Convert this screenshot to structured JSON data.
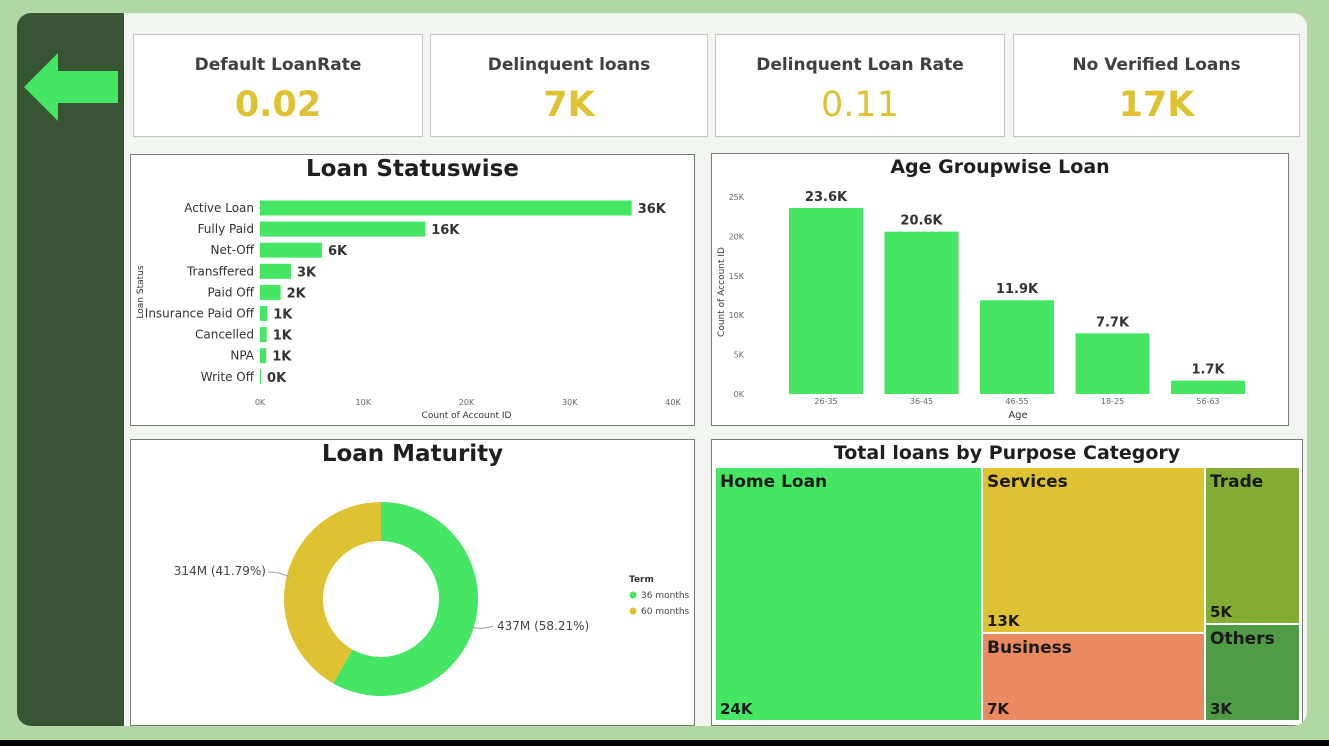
{
  "nav": {
    "back_icon": "arrow-left-icon",
    "accent": "#45e663"
  },
  "kpis": [
    {
      "label": "Default LoanRate",
      "value": "0.02"
    },
    {
      "label": "Delinquent loans",
      "value": "7K"
    },
    {
      "label": "Delinquent Loan Rate",
      "value": "0.11"
    },
    {
      "label": "No Verified Loans",
      "value": "17K"
    }
  ],
  "colors": {
    "green": "#45e663",
    "gold": "#dfc232",
    "salmon": "#ea8a60",
    "olive": "#83ad34",
    "dark_green": "#4f9b46"
  },
  "chart_data": [
    {
      "type": "bar",
      "orientation": "horizontal",
      "title": "Loan Statuswise",
      "xlabel": "Count of Account ID",
      "ylabel": "Loan Status",
      "categories": [
        "Active Loan",
        "Fully Paid",
        "Net-Off",
        "Transffered",
        "Paid Off",
        "Insurance Paid Off",
        "Cancelled",
        "NPA",
        "Write Off"
      ],
      "values": [
        36000,
        16000,
        6000,
        3000,
        2000,
        700,
        650,
        600,
        100
      ],
      "data_labels": [
        "36K",
        "16K",
        "6K",
        "3K",
        "2K",
        "1K",
        "1K",
        "1K",
        "0K"
      ],
      "xlim": [
        0,
        40000
      ],
      "ticks": [
        "0K",
        "10K",
        "20K",
        "30K",
        "40K"
      ]
    },
    {
      "type": "bar",
      "title": "Age Groupwise Loan",
      "xlabel": "Age",
      "ylabel": "Count of Account ID",
      "categories": [
        "26-35",
        "36-45",
        "46-55",
        "18-25",
        "56-63"
      ],
      "values": [
        23600,
        20600,
        11900,
        7700,
        1700
      ],
      "data_labels": [
        "23.6K",
        "20.6K",
        "11.9K",
        "7.7K",
        "1.7K"
      ],
      "ylim": [
        0,
        25000
      ],
      "ticks": [
        "0K",
        "5K",
        "10K",
        "15K",
        "20K",
        "25K"
      ]
    },
    {
      "type": "pie",
      "title": "Loan Maturity",
      "legend_title": "Term",
      "legend_position": "right",
      "series": [
        {
          "name": "36 months",
          "value": 437,
          "label": "437M (58.21%)"
        },
        {
          "name": "60 months",
          "value": 314,
          "label": "314M (41.79%)"
        }
      ]
    },
    {
      "type": "treemap",
      "title": "Total loans by Purpose Category",
      "items": [
        {
          "name": "Home Loan",
          "value_label": "24K"
        },
        {
          "name": "Services",
          "value_label": "13K"
        },
        {
          "name": "Business",
          "value_label": "7K"
        },
        {
          "name": "Trade",
          "value_label": "5K"
        },
        {
          "name": "Others",
          "value_label": "3K"
        }
      ]
    }
  ]
}
